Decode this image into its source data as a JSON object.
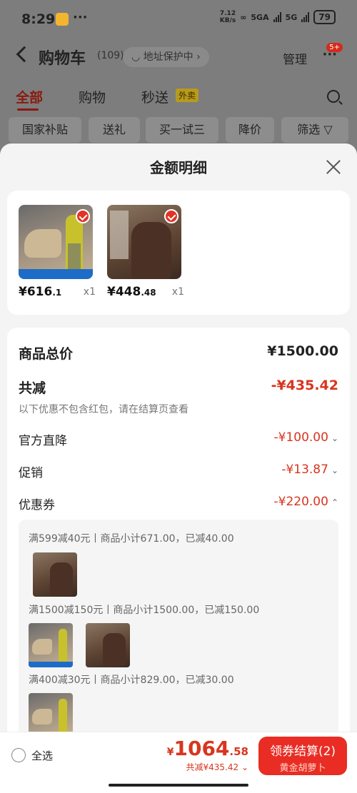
{
  "status_bar": {
    "time": "8:29",
    "dots": "···",
    "speed_top": "7.12",
    "speed_bottom": "KB/s",
    "net1": "5GA",
    "net2": "5G",
    "battery": "79"
  },
  "nav": {
    "title": "购物车",
    "count": "(109)",
    "address_badge": "地址保护中",
    "manage": "管理",
    "more": "···",
    "notification_count": "5+"
  },
  "tabs": {
    "all": "全部",
    "shopping": "购物",
    "instant": "秒送",
    "instant_tag": "外卖"
  },
  "filter_chips": [
    "国家补贴",
    "送礼",
    "买一试三",
    "降价",
    "筛选"
  ],
  "sheet": {
    "title": "金额明细",
    "products": [
      {
        "price_int": "¥616",
        "price_dec": ".1",
        "qty": "x1",
        "icon": "running-shoe"
      },
      {
        "price_int": "¥448",
        "price_dec": ".48",
        "qty": "x1",
        "icon": "down-jacket"
      }
    ],
    "summary": {
      "total_label": "商品总价",
      "total_value": "¥1500.00",
      "reduce_label": "共减",
      "reduce_value": "-¥435.42",
      "note": "以下优惠不包含红包，请在结算页查看",
      "official_label": "官方直降",
      "official_value": "-¥100.00",
      "promo_label": "促销",
      "promo_value": "-¥13.87",
      "coupon_label": "优惠券",
      "coupon_value": "-¥220.00"
    },
    "coupons": [
      "满599减40元丨商品小计671.00，已减40.00",
      "满1500减150元丨商品小计1500.00，已减150.00",
      "满400减30元丨商品小计829.00，已减30.00"
    ]
  },
  "bottom_bar": {
    "select_all": "全选",
    "currency": "¥",
    "total_int": "1064",
    "total_dec": ".58",
    "saved": "共减¥435.42",
    "checkout": "领券结算(2)",
    "checkout_sub": "黄金胡萝卜"
  },
  "colors": {
    "accent_red": "#e92d24",
    "price_red": "#d8351e",
    "overlay_gray": "#7d7d7d"
  }
}
